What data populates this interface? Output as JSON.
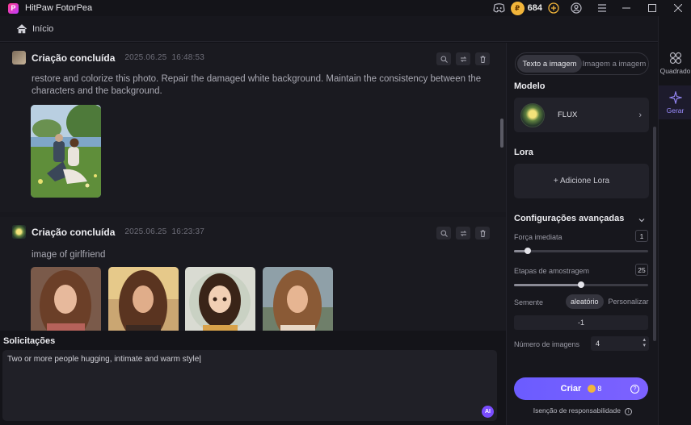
{
  "app": {
    "title": "HitPaw FotorPea",
    "logo_letter": "P",
    "credits": "684"
  },
  "breadcrumb": {
    "home_label": "Início"
  },
  "feed": {
    "cards": [
      {
        "title": "Criação concluída",
        "date": "2025.06.25",
        "time": "16:48:53",
        "prompt": "restore and colorize this photo. Repair the damaged white background. Maintain the consistency between the characters and the background."
      },
      {
        "title": "Criação concluída",
        "date": "2025.06.25",
        "time": "16:23:37",
        "prompt": "image of girlfriend"
      }
    ]
  },
  "prompt_box": {
    "label": "Solicitações",
    "value": "Two or more people hugging, intimate and warm style",
    "ai_badge": "AI"
  },
  "panel": {
    "tabs": [
      "Texto a imagem",
      "Imagem a imagem"
    ],
    "active_tab": 0,
    "model_heading": "Modelo",
    "model_name": "FLUX",
    "lora_heading": "Lora",
    "lora_button": "+ Adicione Lora",
    "advanced_heading": "Configurações avançadas",
    "strength_label": "Força imediata",
    "strength_value": "1",
    "strength_level": 0.1,
    "steps_label": "Etapas de amostragem",
    "steps_value": "25",
    "steps_level": 0.5,
    "seed_label": "Semente",
    "seed_options": [
      "aleatório",
      "Personalizar"
    ],
    "seed_value": "-1",
    "count_label": "Número de imagens",
    "count_value": "4",
    "create_label": "Criar",
    "create_cost": "8",
    "disclaimer": "Isenção de responsabilidade"
  },
  "rail": {
    "items": [
      "Quadrado",
      "Gerar"
    ]
  },
  "colors": {
    "accent": "#7b61ff",
    "coin": "#f2b53a",
    "background": "#121218"
  }
}
